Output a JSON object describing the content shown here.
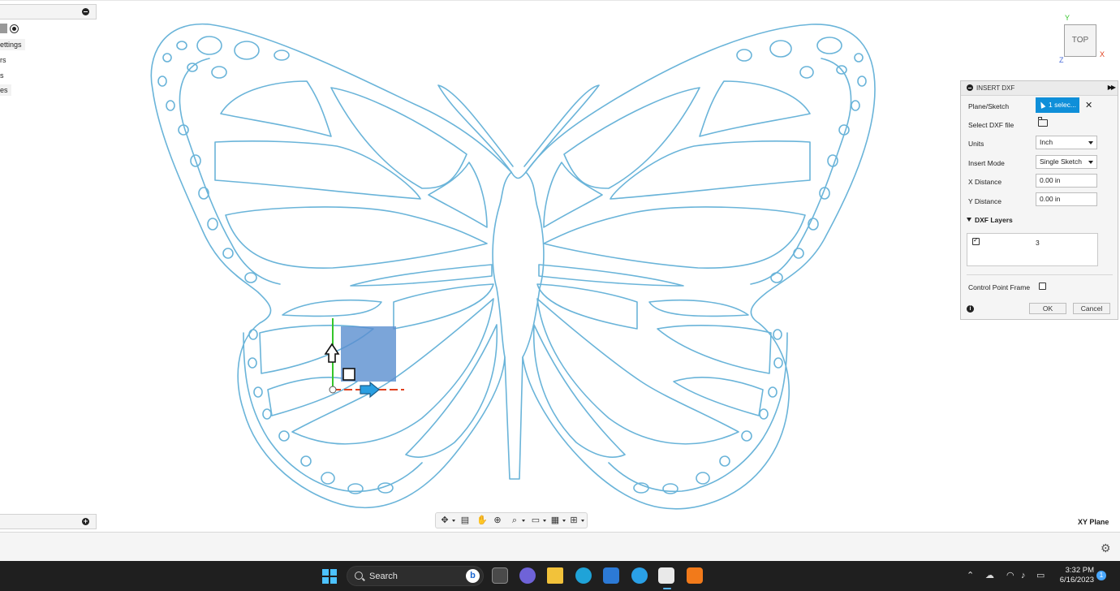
{
  "browser": {
    "items": [
      {
        "label": "ettings"
      },
      {
        "label": "rs"
      },
      {
        "label": "s"
      },
      {
        "label": "es"
      }
    ]
  },
  "viewcube": {
    "face": "TOP",
    "axis_x": "X",
    "axis_y": "Y",
    "axis_z": "Z"
  },
  "dialog": {
    "title": "INSERT DXF",
    "plane_label": "Plane/Sketch",
    "plane_value": "1 selec...",
    "file_label": "Select DXF file",
    "units_label": "Units",
    "units_value": "Inch",
    "mode_label": "Insert Mode",
    "mode_value": "Single Sketch",
    "xdist_label": "X Distance",
    "xdist_value": "0.00 in",
    "ydist_label": "Y Distance",
    "ydist_value": "0.00 in",
    "layers_label": "DXF Layers",
    "layers": [
      {
        "name": "3",
        "checked": true
      }
    ],
    "cpf_label": "Control Point Frame",
    "ok": "OK",
    "cancel": "Cancel"
  },
  "plane_readout": "XY Plane",
  "taskbar": {
    "search_label": "Search",
    "time": "3:32 PM",
    "date": "6/16/2023",
    "notifications": "1"
  },
  "colors": {
    "sketch_line": "#6ab4d9",
    "select_blue": "#0f8fd9",
    "preview_fill": "#5a8fcf",
    "x_axis": "#e0401e",
    "y_axis": "#35c52a"
  }
}
